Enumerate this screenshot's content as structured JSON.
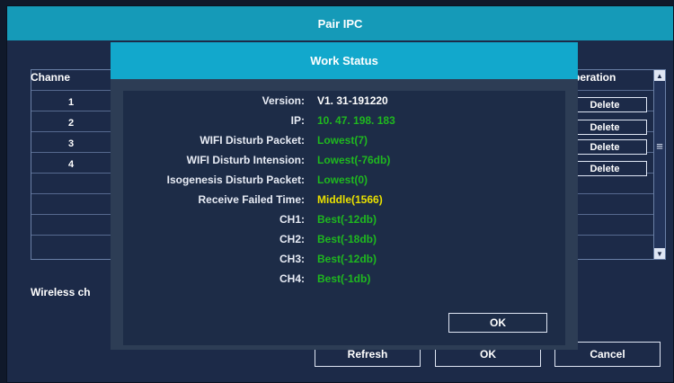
{
  "window": {
    "title": "Pair IPC"
  },
  "table": {
    "header_channel": "Channe",
    "header_operation": ")peration",
    "channels": [
      "1",
      "2",
      "3",
      "4"
    ],
    "delete_label": "Delete"
  },
  "wireless_label": "Wireless ch",
  "buttons": {
    "refresh": "Refresh",
    "ok": "OK",
    "cancel": "Cancel"
  },
  "modal": {
    "title": "Work Status",
    "rows": [
      {
        "label": "Version:",
        "value": "V1. 31-191220",
        "color": "#ffffff"
      },
      {
        "label": "IP:",
        "value": "10. 47. 198. 183",
        "color": "#1fb81f"
      },
      {
        "label": "WIFI Disturb Packet:",
        "value": "Lowest(7)",
        "color": "#1fb81f"
      },
      {
        "label": "WIFI Disturb Intension:",
        "value": "Lowest(-76db)",
        "color": "#1fb81f"
      },
      {
        "label": "Isogenesis Disturb Packet:",
        "value": "Lowest(0)",
        "color": "#1fb81f"
      },
      {
        "label": "Receive Failed Time:",
        "value": "Middle(1566)",
        "color": "#e8e000"
      },
      {
        "label": "CH1:",
        "value": "Best(-12db)",
        "color": "#1fb81f"
      },
      {
        "label": "CH2:",
        "value": "Best(-18db)",
        "color": "#1fb81f"
      },
      {
        "label": "CH3:",
        "value": "Best(-12db)",
        "color": "#1fb81f"
      },
      {
        "label": "CH4:",
        "value": "Best(-1db)",
        "color": "#1fb81f"
      }
    ],
    "ok_label": "OK"
  },
  "colors": {
    "title_bar": "#159ab8",
    "modal_title_bar": "#12a8cc",
    "window_bg": "#1c2a48",
    "status_good": "#1fb81f",
    "status_warning": "#e8e000"
  },
  "icons": {
    "scroll_up": "arrow-up-icon",
    "scroll_down": "arrow-down-icon",
    "scroll_thumb": "scroll-grip-icon"
  }
}
